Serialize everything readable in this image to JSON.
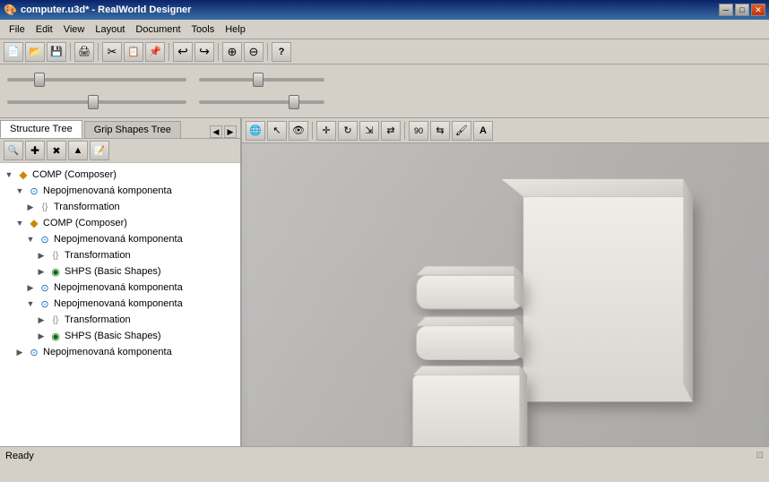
{
  "titlebar": {
    "icon": "🎨",
    "title": "computer.u3d* - RealWorld Designer",
    "minimize": "─",
    "maximize": "□",
    "close": "✕"
  },
  "menubar": {
    "items": [
      "File",
      "Edit",
      "View",
      "Layout",
      "Document",
      "Tools",
      "Help"
    ]
  },
  "toolbar1": {
    "buttons": [
      {
        "name": "new",
        "icon": "📄"
      },
      {
        "name": "open",
        "icon": "📂"
      },
      {
        "name": "save",
        "icon": "💾"
      },
      {
        "name": "print",
        "icon": "🖨"
      },
      {
        "name": "cut",
        "icon": "✂"
      },
      {
        "name": "copy",
        "icon": "📋"
      },
      {
        "name": "paste",
        "icon": "📌"
      },
      {
        "name": "undo",
        "icon": "↩"
      },
      {
        "name": "redo",
        "icon": "↪"
      },
      {
        "name": "zoom-in",
        "icon": "🔍"
      },
      {
        "name": "zoom-out",
        "icon": "🔍"
      },
      {
        "name": "help",
        "icon": "?"
      }
    ]
  },
  "toolbar2": {
    "buttons": [
      {
        "name": "globe",
        "icon": "🌐"
      },
      {
        "name": "arrow",
        "icon": "↗"
      },
      {
        "name": "target",
        "icon": "🎯"
      },
      {
        "name": "move",
        "icon": "✛"
      },
      {
        "name": "transform1",
        "icon": "⟲"
      },
      {
        "name": "transform2",
        "icon": "⟳"
      },
      {
        "name": "flip",
        "icon": "⇄"
      },
      {
        "name": "rotate90",
        "icon": "↻"
      },
      {
        "name": "mirror",
        "icon": "⇆"
      },
      {
        "name": "flip-v",
        "icon": "⇅"
      },
      {
        "name": "paint",
        "icon": "🖌"
      },
      {
        "name": "text-a",
        "icon": "A"
      }
    ]
  },
  "tabs": {
    "structure": "Structure Tree",
    "grip": "Grip Shapes Tree"
  },
  "tree": {
    "items": [
      {
        "id": "comp1",
        "label": "COMP (Composer)",
        "level": 0,
        "type": "composer",
        "expanded": true,
        "expander": "▼"
      },
      {
        "id": "unnamed1",
        "label": "Nepojmenovaná komponenta",
        "level": 1,
        "type": "component",
        "expanded": true,
        "expander": "▼"
      },
      {
        "id": "trans1",
        "label": "Transformation",
        "level": 2,
        "type": "transform",
        "expanded": false,
        "expander": "▶"
      },
      {
        "id": "comp2",
        "label": "COMP (Composer)",
        "level": 1,
        "type": "composer",
        "expanded": true,
        "expander": "▼"
      },
      {
        "id": "unnamed2",
        "label": "Nepojmenovaná komponenta",
        "level": 2,
        "type": "component",
        "expanded": true,
        "expander": "▼"
      },
      {
        "id": "trans2",
        "label": "Transformation",
        "level": 3,
        "type": "transform",
        "expanded": false,
        "expander": "▶"
      },
      {
        "id": "shps1",
        "label": "SHPS (Basic Shapes)",
        "level": 3,
        "type": "shape",
        "expanded": false,
        "expander": "▶"
      },
      {
        "id": "unnamed3",
        "label": "Nepojmenovaná komponenta",
        "level": 2,
        "type": "component",
        "expanded": false,
        "expander": "▶"
      },
      {
        "id": "unnamed4",
        "label": "Nepojmenovaná komponenta",
        "level": 2,
        "type": "component",
        "expanded": true,
        "expander": "▼"
      },
      {
        "id": "trans3",
        "label": "Transformation",
        "level": 3,
        "type": "transform",
        "expanded": false,
        "expander": "▶"
      },
      {
        "id": "shps2",
        "label": "SHPS (Basic Shapes)",
        "level": 3,
        "type": "shape",
        "expanded": false,
        "expander": "▶"
      },
      {
        "id": "unnamed5",
        "label": "Nepojmenovaná komponenta",
        "level": 1,
        "type": "component",
        "expanded": false,
        "expander": "▶"
      }
    ]
  },
  "statusbar": {
    "text": "Ready"
  }
}
